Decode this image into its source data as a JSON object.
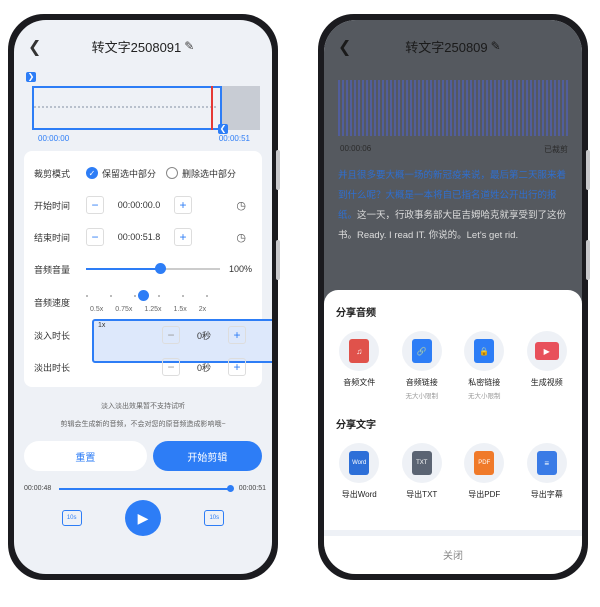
{
  "left": {
    "title": "转文字2508091",
    "time_start": "00:00:00",
    "time_end": "00:00:51",
    "mode_label": "裁剪模式",
    "keep_option": "保留选中部分",
    "delete_option": "删除选中部分",
    "start_label": "开始时间",
    "start_value": "00:00:00.0",
    "end_label": "结束时间",
    "end_value": "00:00:51.8",
    "volume_label": "音频音量",
    "volume_value": "100%",
    "volume_level": 0.55,
    "speed_label": "音频速度",
    "speeds": [
      "0.5x",
      "0.75x",
      "1x",
      "1.25x",
      "1.5x",
      "2x"
    ],
    "fade_in_label": "淡入时长",
    "fade_in_value": "0秒",
    "fade_out_label": "淡出时长",
    "fade_out_value": "0秒",
    "note1": "淡入淡出效果暂不支持试听",
    "note2": "剪辑会生成新的音频，不会对您的原音频造成影响哦~",
    "reset": "重置",
    "start": "开始剪辑",
    "play_current": "00:00:48",
    "play_total": "00:00:51",
    "skip_back": "10s",
    "skip_fwd": "10s"
  },
  "right": {
    "title": "转文字250809",
    "time_start": "00:00:06",
    "time_end": "已裁剪",
    "transcript_hl": "并且很多要大概一场的新冠疫来说，最后第二天服来着到什么呢？大概是一本将自已指名道姓公开出行的报纸。",
    "transcript_rest": "这一天，行政事务部大臣吉姆哈克就享受到了这份书。Ready. I read IT. 你说的。Let's get rid.",
    "audio_head": "分享音频",
    "audio_items": [
      {
        "label": "音频文件",
        "sub": ""
      },
      {
        "label": "音频链接",
        "sub": "无大小限制"
      },
      {
        "label": "私密链接",
        "sub": "无大小限制"
      },
      {
        "label": "生成视频",
        "sub": ""
      }
    ],
    "text_head": "分享文字",
    "text_items": [
      {
        "label": "导出Word",
        "tag": "Word"
      },
      {
        "label": "导出TXT",
        "tag": "TXT"
      },
      {
        "label": "导出PDF",
        "tag": "PDF"
      },
      {
        "label": "导出字幕",
        "tag": "≡"
      }
    ],
    "close": "关闭"
  }
}
